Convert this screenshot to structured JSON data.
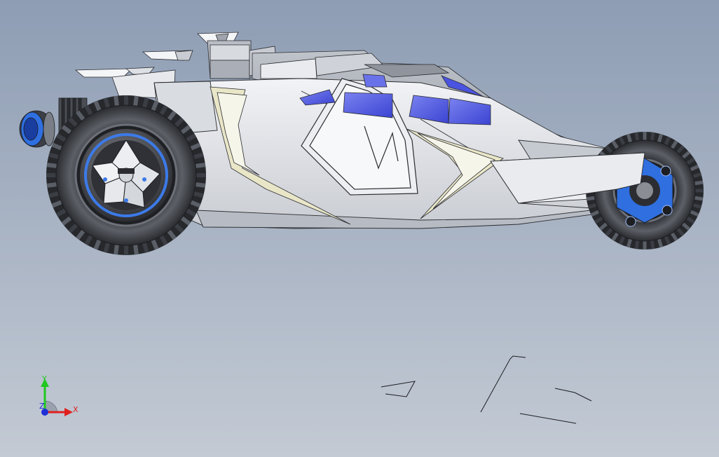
{
  "viewport": {
    "background_top": "#8e9db4",
    "background_bottom": "#c3cad4"
  },
  "triad": {
    "y_label": "Y",
    "x_label": "X",
    "z_label": "Z",
    "y_color": "#1ec81e",
    "x_color": "#e02020",
    "z_color": "#1d2fd6"
  },
  "model": {
    "body_color": "#e4e6ea",
    "body_shadow": "#b4b8c0",
    "glass_color": "#5a63e6",
    "accent_blue": "#2f6fe0",
    "tire_color": "#4e5157",
    "tire_dark": "#26282c",
    "trim_color": "#e9e6c8",
    "edge_color": "#2a2c30"
  }
}
